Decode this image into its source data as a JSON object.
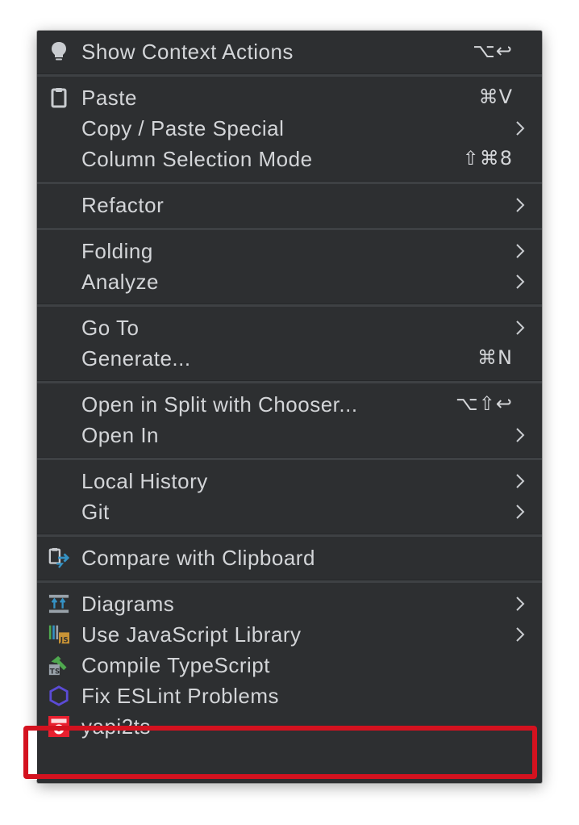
{
  "menu": {
    "sections": [
      [
        {
          "label": "Show Context Actions",
          "shortcut": "⌥↩",
          "icon": "lightbulb-icon"
        }
      ],
      [
        {
          "label": "Paste",
          "shortcut": "⌘V",
          "icon": "clipboard-icon"
        },
        {
          "label": "Copy / Paste Special",
          "submenu": true
        },
        {
          "label": "Column Selection Mode",
          "shortcut": "⇧⌘8"
        }
      ],
      [
        {
          "label": "Refactor",
          "submenu": true
        }
      ],
      [
        {
          "label": "Folding",
          "submenu": true
        },
        {
          "label": "Analyze",
          "submenu": true
        }
      ],
      [
        {
          "label": "Go To",
          "submenu": true
        },
        {
          "label": "Generate...",
          "shortcut": "⌘N"
        }
      ],
      [
        {
          "label": "Open in Split with Chooser...",
          "shortcut": "⌥⇧↩"
        },
        {
          "label": "Open In",
          "submenu": true
        }
      ],
      [
        {
          "label": "Local History",
          "submenu": true
        },
        {
          "label": "Git",
          "submenu": true
        }
      ],
      [
        {
          "label": "Compare with Clipboard",
          "icon": "compare-clipboard-icon"
        }
      ],
      [
        {
          "label": "Diagrams",
          "submenu": true,
          "icon": "diagram-icon"
        },
        {
          "label": "Use JavaScript Library",
          "submenu": true,
          "icon": "js-library-icon"
        },
        {
          "label": "Compile TypeScript",
          "icon": "typescript-compile-icon"
        },
        {
          "label": "Fix ESLint Problems",
          "icon": "eslint-icon"
        },
        {
          "label": "yapi2ts",
          "icon": "yapi-icon"
        }
      ]
    ]
  },
  "colors": {
    "menu_bg": "#2d2f31",
    "text": "#d3d5d8",
    "highlight_border": "#d4121f"
  }
}
